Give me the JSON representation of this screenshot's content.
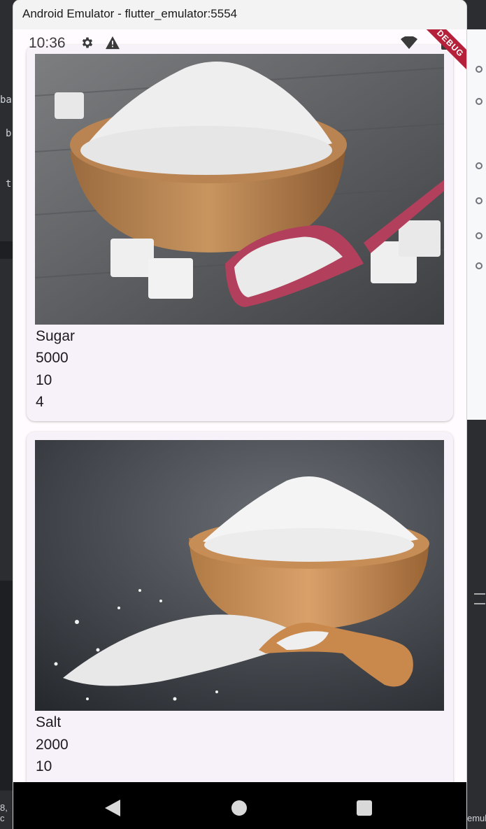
{
  "window": {
    "title": "Android Emulator - flutter_emulator:5554"
  },
  "status_bar": {
    "time": "10:36",
    "debug_label": "DEBUG"
  },
  "ide_fragments": {
    "left": [
      "ba",
      "b",
      "t"
    ],
    "bottom_left": "8, c",
    "bottom_right": "emul"
  },
  "products": [
    {
      "name": "Sugar",
      "price": "5000",
      "quantity": "10",
      "rating": "4",
      "image": "sugar-bowl-photo"
    },
    {
      "name": "Salt",
      "price": "2000",
      "quantity": "10",
      "image": "salt-bowl-photo"
    }
  ],
  "colors": {
    "screen_bg": "#fffbfe",
    "card_bg": "#f7f2fa",
    "debug_banner": "#b5213b",
    "nav_bar": "#000000"
  }
}
